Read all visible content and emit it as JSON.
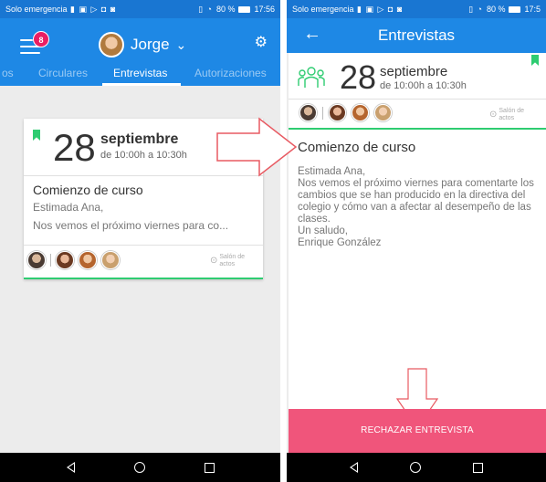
{
  "left": {
    "statusbar": {
      "carrier": "Solo emergencia",
      "battery": "80 %",
      "time": "17:56"
    },
    "header": {
      "notifications_count": "8",
      "user_name": "Jorge"
    },
    "tabs": [
      {
        "label": "os"
      },
      {
        "label": "Circulares"
      },
      {
        "label": "Entrevistas"
      },
      {
        "label": "Autorizaciones"
      }
    ],
    "card": {
      "day": "28",
      "month": "septiembre",
      "hours": "de 10:00h a 10:30h",
      "subject": "Comienzo de curso",
      "greeting": "Estimada Ana,",
      "preview": "Nos vemos el próximo viernes para co...",
      "location": "Salón de actos"
    }
  },
  "right": {
    "statusbar": {
      "carrier": "Solo emergencia",
      "battery": "80 %",
      "time": "17:5"
    },
    "header": {
      "title": "Entrevistas"
    },
    "detail": {
      "day": "28",
      "month": "septiembre",
      "hours": "de 10:00h a 10:30h",
      "location": "Salón de actos",
      "subject": "Comienzo de curso",
      "body": "Estimada Ana,\nNos vemos el próximo viernes para comentarte los cambios que se han producido en la directiva del colegio y cómo van a afectar al desempeño de las clases.\nUn saludo,\nEnrique González"
    },
    "reject_label": "RECHAZAR ENTREVISTA"
  },
  "colors": {
    "primary": "#1e88e5",
    "accent_green": "#2ecc71",
    "reject_pink": "#f0557b",
    "badge": "#e91e63"
  },
  "icons": [
    "menu-icon",
    "gear-icon",
    "chevron-down-icon",
    "bookmark-icon",
    "arrow-right-circle-icon",
    "location-pin-icon",
    "back-arrow-icon",
    "people-icon"
  ]
}
